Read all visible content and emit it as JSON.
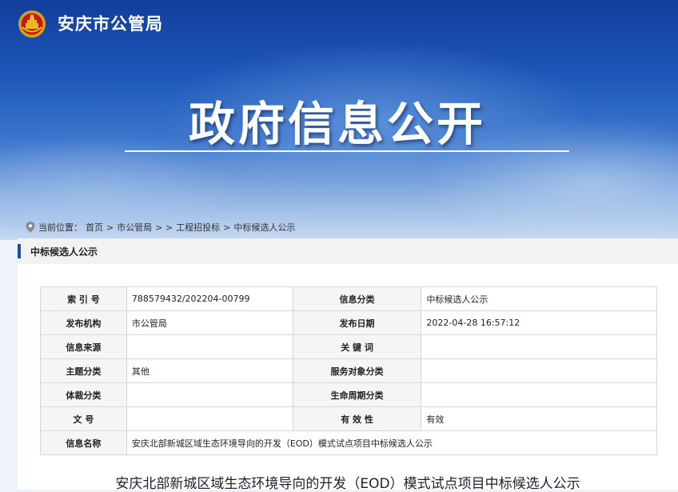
{
  "header": {
    "site_title": "安庆市公管局",
    "hero_title": "政府信息公开",
    "emblem_icon": "national-emblem-icon"
  },
  "breadcrumb": {
    "prefix": "当前位置：",
    "items": [
      "首页",
      "市公管局",
      "> >",
      "工程招投标",
      "中标候选人公示"
    ],
    "separator": ">"
  },
  "panel": {
    "title": "中标候选人公示"
  },
  "meta": {
    "rows": [
      {
        "l1": "索 引 号",
        "v1": "788579432/202204-00799",
        "l2": "信息分类",
        "v2": "中标候选人公示"
      },
      {
        "l1": "发布机构",
        "v1": "市公管局",
        "l2": "发布日期",
        "v2": "2022-04-28 16:57:12"
      },
      {
        "l1": "信息来源",
        "v1": "",
        "l2": "关 键 词",
        "v2": ""
      },
      {
        "l1": "主题分类",
        "v1": "其他",
        "l2": "服务对象分类",
        "v2": ""
      },
      {
        "l1": "体裁分类",
        "v1": "",
        "l2": "生命周期分类",
        "v2": ""
      },
      {
        "l1": "文 号",
        "v1": "",
        "l2": "有 效 性",
        "v2": "有效"
      }
    ],
    "name_label": "信息名称",
    "name_value": "安庆北部新城区域生态环境导向的开发（EOD）模式试点项目中标候选人公示"
  },
  "document": {
    "title": "安庆北部新城区域生态环境导向的开发（EOD）模式试点项目中标候选人公示"
  },
  "colors": {
    "accent": "#1a4fa8",
    "banner_top": "#123e9c",
    "banner_bottom": "#c9daf1"
  }
}
